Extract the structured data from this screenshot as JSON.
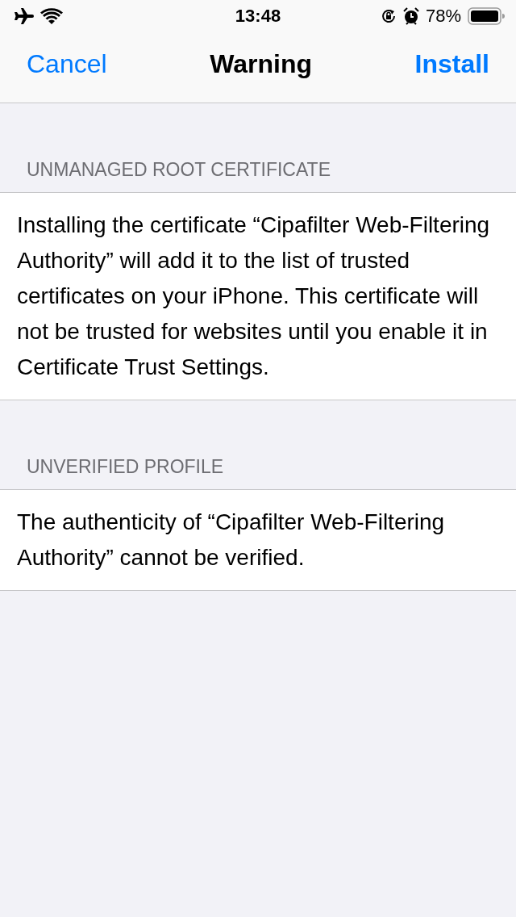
{
  "status_bar": {
    "time": "13:48",
    "battery": "78%"
  },
  "nav_bar": {
    "left_button": "Cancel",
    "title": "Warning",
    "right_button": "Install"
  },
  "sections": [
    {
      "header": "UNMANAGED ROOT CERTIFICATE",
      "text": "Installing the certificate “Cipafilter Web-Filtering Authority” will add it to the list of trusted certificates on your iPhone. This certificate will not be trusted for websites until you enable it in Certificate Trust Settings."
    },
    {
      "header": "UNVERIFIED PROFILE",
      "text": "The authenticity of “Cipafilter Web-Filtering Authority” cannot be verified."
    }
  ]
}
